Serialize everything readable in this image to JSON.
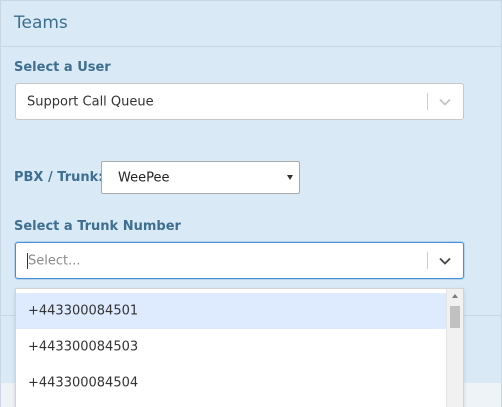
{
  "header": {
    "title": "Teams"
  },
  "user_select": {
    "label": "Select a User",
    "value": "Support Call Queue"
  },
  "pbx": {
    "label": "PBX / Trunk:",
    "value": "WeePee"
  },
  "trunk_number": {
    "label": "Select a Trunk Number",
    "placeholder": "Select...",
    "options": [
      "+443300084501",
      "+443300084503",
      "+443300084504"
    ]
  },
  "colors": {
    "panel_bg": "#d9eaf6",
    "label": "#3e6f90",
    "focus_border": "#4a8fd6",
    "option_highlight": "#deebff"
  }
}
